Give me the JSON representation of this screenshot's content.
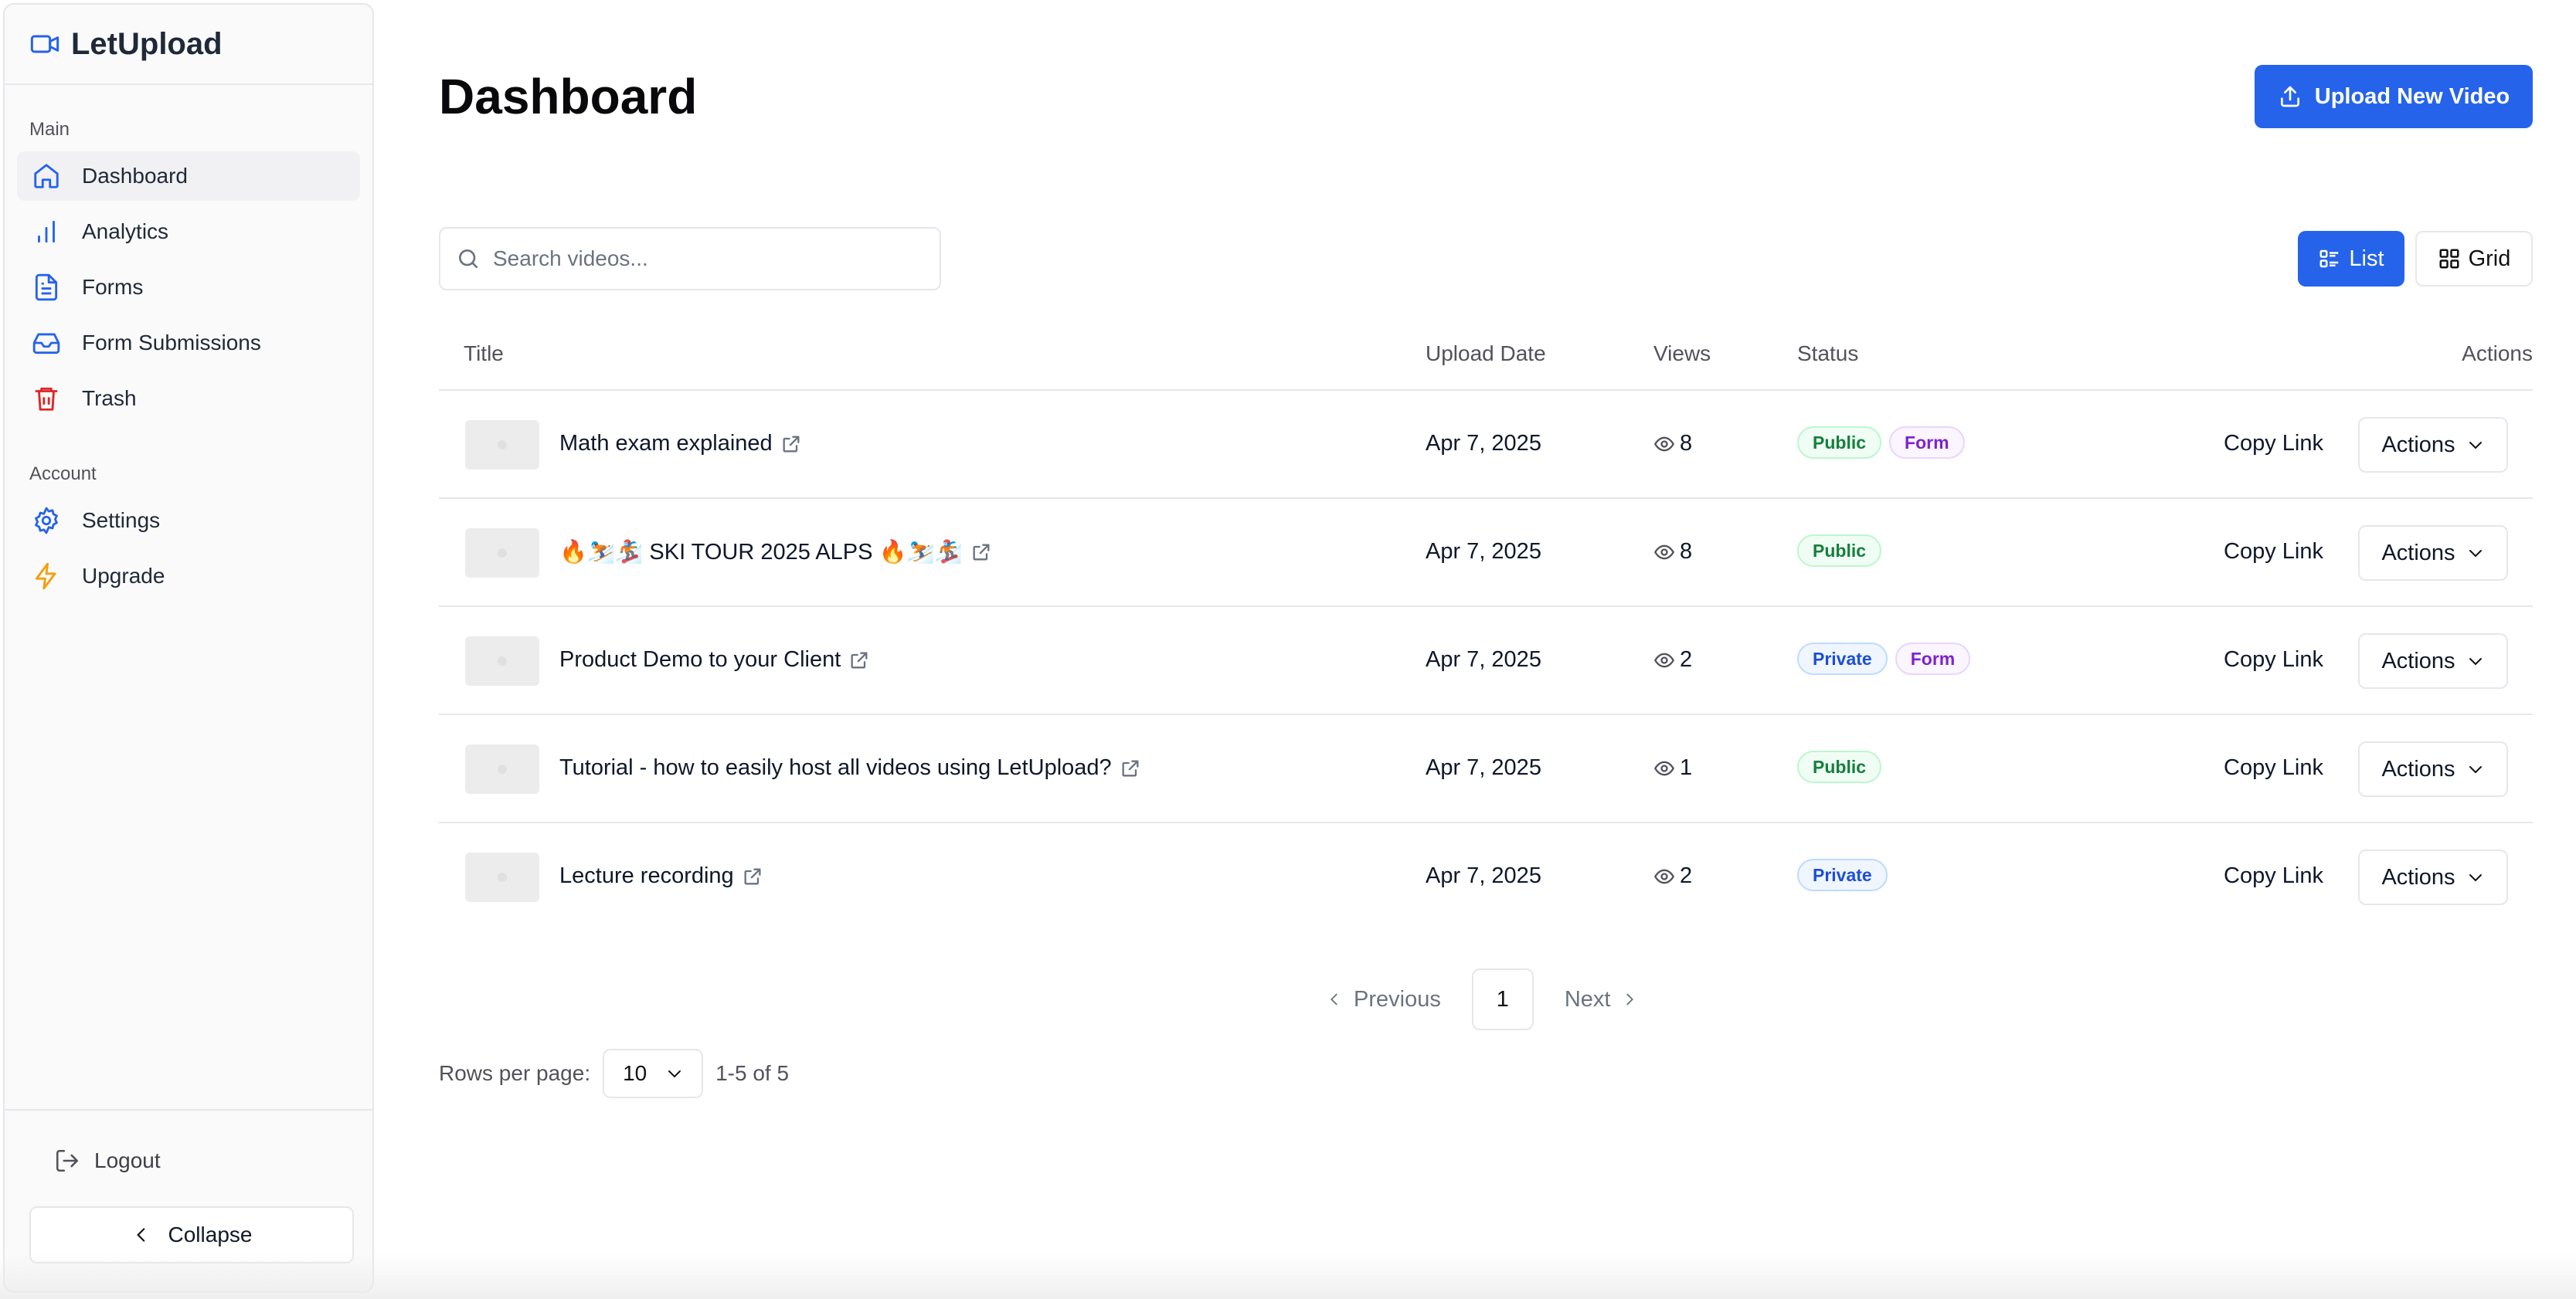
{
  "app": {
    "name": "LetUpload"
  },
  "sidebar": {
    "main_label": "Main",
    "main_items": [
      {
        "label": "Dashboard",
        "icon": "home-icon",
        "active": true
      },
      {
        "label": "Analytics",
        "icon": "bar-chart-icon"
      },
      {
        "label": "Forms",
        "icon": "document-icon"
      },
      {
        "label": "Form Submissions",
        "icon": "inbox-icon"
      },
      {
        "label": "Trash",
        "icon": "trash-icon"
      }
    ],
    "account_label": "Account",
    "account_items": [
      {
        "label": "Settings",
        "icon": "gear-icon"
      },
      {
        "label": "Upgrade",
        "icon": "lightning-icon"
      }
    ],
    "logout": "Logout",
    "collapse": "Collapse"
  },
  "header": {
    "title": "Dashboard",
    "upload_button": "Upload New Video"
  },
  "search": {
    "placeholder": "Search videos..."
  },
  "view_toggle": {
    "list": "List",
    "grid": "Grid",
    "selected": "List"
  },
  "table": {
    "columns": {
      "title": "Title",
      "upload_date": "Upload Date",
      "views": "Views",
      "status": "Status",
      "actions": "Actions"
    },
    "rows": [
      {
        "title": "Math exam explained",
        "date": "Apr 7, 2025",
        "views": "8",
        "status": "Public",
        "form": "Form",
        "copy": "Copy Link",
        "actions": "Actions"
      },
      {
        "title": "🔥⛷️🏂 SKI TOUR 2025 ALPS 🔥⛷️🏂",
        "date": "Apr 7, 2025",
        "views": "8",
        "status": "Public",
        "form": "",
        "copy": "Copy Link",
        "actions": "Actions"
      },
      {
        "title": "Product Demo to your Client",
        "date": "Apr 7, 2025",
        "views": "2",
        "status": "Private",
        "form": "Form",
        "copy": "Copy Link",
        "actions": "Actions"
      },
      {
        "title": "Tutorial - how to easily host all videos using LetUpload?",
        "date": "Apr 7, 2025",
        "views": "1",
        "status": "Public",
        "form": "",
        "copy": "Copy Link",
        "actions": "Actions"
      },
      {
        "title": "Lecture recording",
        "date": "Apr 7, 2025",
        "views": "2",
        "status": "Private",
        "form": "",
        "copy": "Copy Link",
        "actions": "Actions"
      }
    ]
  },
  "pagination": {
    "previous": "Previous",
    "next": "Next",
    "current": "1",
    "rows_per_page_label": "Rows per page:",
    "rows_per_page_value": "10",
    "range": "1-5 of 5"
  },
  "colors": {
    "accent": "#2563eb",
    "public": "#15803d",
    "private": "#1d4ed8",
    "form": "#7e22ce",
    "trash": "#dc2626",
    "upgrade": "#f59e0b"
  }
}
